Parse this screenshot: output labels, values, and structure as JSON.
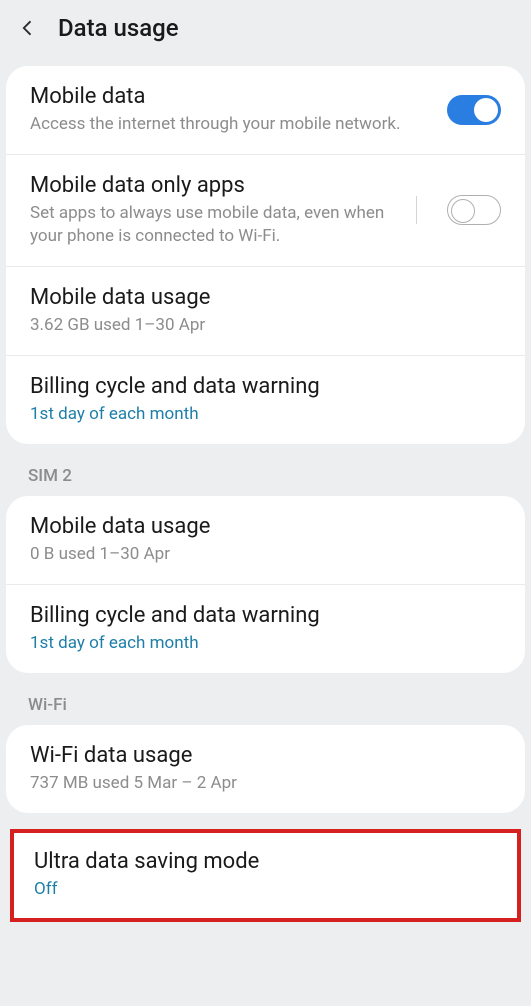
{
  "header": {
    "title": "Data usage"
  },
  "section1": {
    "mobile_data": {
      "title": "Mobile data",
      "sub": "Access the internet through your mobile network."
    },
    "mobile_only": {
      "title": "Mobile data only apps",
      "sub": "Set apps to always use mobile data, even when your phone is connected to Wi-Fi."
    },
    "usage": {
      "title": "Mobile data usage",
      "sub": "3.62 GB used 1–30 Apr"
    },
    "billing": {
      "title": "Billing cycle and data warning",
      "sub": "1st day of each month"
    }
  },
  "sim2": {
    "label": "SIM 2",
    "usage": {
      "title": "Mobile data usage",
      "sub": "0 B used 1–30 Apr"
    },
    "billing": {
      "title": "Billing cycle and data warning",
      "sub": "1st day of each month"
    }
  },
  "wifi": {
    "label": "Wi-Fi",
    "usage": {
      "title": "Wi-Fi data usage",
      "sub": "737 MB used 5 Mar – 2 Apr"
    }
  },
  "ultra": {
    "title": "Ultra data saving mode",
    "sub": "Off"
  }
}
